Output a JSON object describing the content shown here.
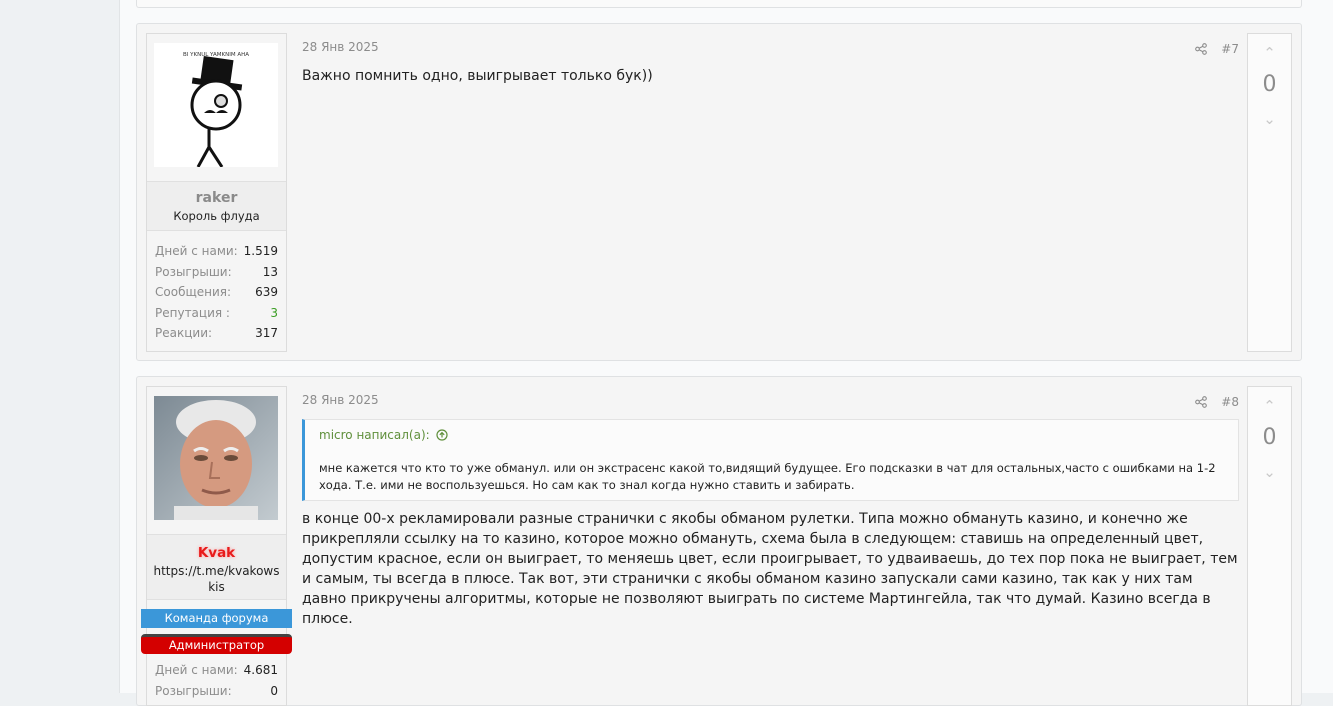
{
  "posts": [
    {
      "date": "28 Янв 2025",
      "number": "#7",
      "user": {
        "name": "raker",
        "title": "Король флуда",
        "avatar_text": "BI YKNUL YAMKNIM AHA",
        "stats": [
          {
            "label": "Дней с нами:",
            "value": "1.519"
          },
          {
            "label": "Розыгрыши:",
            "value": "13"
          },
          {
            "label": "Сообщения:",
            "value": "639"
          },
          {
            "label": "Репутация :",
            "value": "3"
          },
          {
            "label": "Реакции:",
            "value": "317"
          }
        ]
      },
      "text": "Важно помнить одно, выигрывает только бук))",
      "votes": "0"
    },
    {
      "date": "28 Янв 2025",
      "number": "#8",
      "user": {
        "name": "Kvak",
        "subtitle": "https://t.me/kvakowskis",
        "banners": [
          "Команда форума",
          "Администратор"
        ],
        "stats": [
          {
            "label": "Дней с нами:",
            "value": "4.681"
          },
          {
            "label": "Розыгрыши:",
            "value": "0"
          }
        ]
      },
      "quote": {
        "author": "micro написал(а):",
        "text": "мне кажется что кто то уже обманул. или он экстрасенс какой то,видящий будущее. Его подсказки в чат для остальных,часто с ошибками на 1-2 хода. Т.е. ими не воспользуешься. Но сам как то знал когда нужно ставить и забирать."
      },
      "text": "в конце 00-х рекламировали разные странички с якобы обманом рулетки. Типа можно обмануть казино, и конечно же прикрепляли ссылку на то казино, которое можно обмануть, схема была в следующем: ставишь на определенный цвет, допустим красное, если он выиграет, то меняешь цвет, если проигрывает, то удваиваешь, до тех пор пока не выиграет, тем и самым, ты всегда в плюсе. Так вот, эти странички с якобы обманом казино запускали сами казино, так как у них там давно прикручены алгоритмы, которые не позволяют выиграть по системе Мартингейла, так что думай. Казино всегда в плюсе.",
      "votes": "0"
    }
  ],
  "icons": {
    "share": "share-icon",
    "quote_jump": "arrow-up-circle-icon",
    "vote_up": "chevron-up-icon",
    "vote_down": "chevron-down-icon"
  },
  "colors": {
    "accent_blue": "#3b97d9",
    "admin_red": "#d40000",
    "name_red": "#e81a1a",
    "reputation_green": "#3a9d23"
  }
}
